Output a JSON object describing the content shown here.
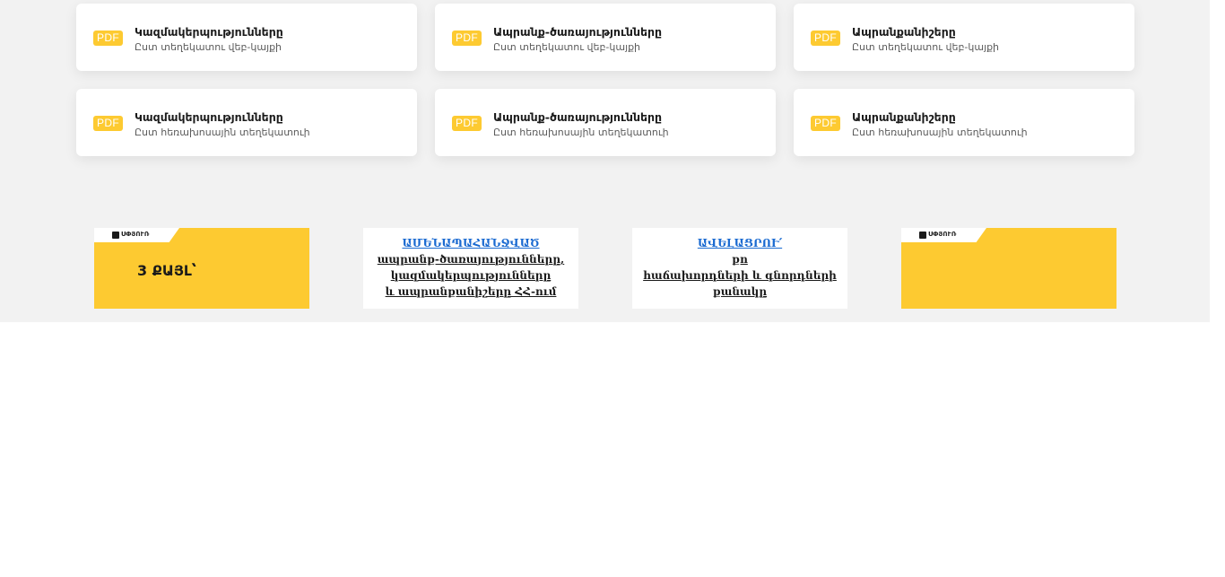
{
  "cards": [
    {
      "badge": "PDF",
      "title": "Կազմակերպությունները",
      "subtitle": "Ըստ տեղեկատու վեբ-կայքի"
    },
    {
      "badge": "PDF",
      "title": "Ապրանք-ծառայությունները",
      "subtitle": "Ըստ տեղեկատու վեբ-կայքի"
    },
    {
      "badge": "PDF",
      "title": "Ապրանքանիշերը",
      "subtitle": "Ըստ տեղեկատու վեբ-կայքի"
    },
    {
      "badge": "PDF",
      "title": "Կազմակերպությունները",
      "subtitle": "Ըստ հեռախոսային տեղեկատուի"
    },
    {
      "badge": "PDF",
      "title": "Ապրանք-ծառայությունները",
      "subtitle": "Ըստ հեռախոսային տեղեկատուի"
    },
    {
      "badge": "PDF",
      "title": "Ապրանքանիշերը",
      "subtitle": "Ըստ հեռախոսային տեղեկատուի"
    }
  ],
  "banners": {
    "b1": {
      "logo": "ՍՓՅՈՒՌ",
      "headline": "3 ՔԱՅԼ՝"
    },
    "b2": {
      "line1": "ԱՄԵՆԱՊԱՀԱՆՋՎԱԾ",
      "line2": "ապրանք-ծառայությունները,",
      "line3": "կազմակերպությունները",
      "line4": "և ապրանքանիշերը ՀՀ-ում"
    },
    "b3": {
      "line1": "ԱՎԵԼԱՑՐՈՒ՛",
      "line2": "քո",
      "line3": "հաճախորդների և գնորդների",
      "line4": "քանակը"
    },
    "b4": {
      "logo": "ՍՓՅՈՒՌ"
    }
  },
  "colors": {
    "accent_yellow": "#fdca31",
    "link_blue": "#1a6ad1",
    "page_gray": "#f2f2f2"
  }
}
